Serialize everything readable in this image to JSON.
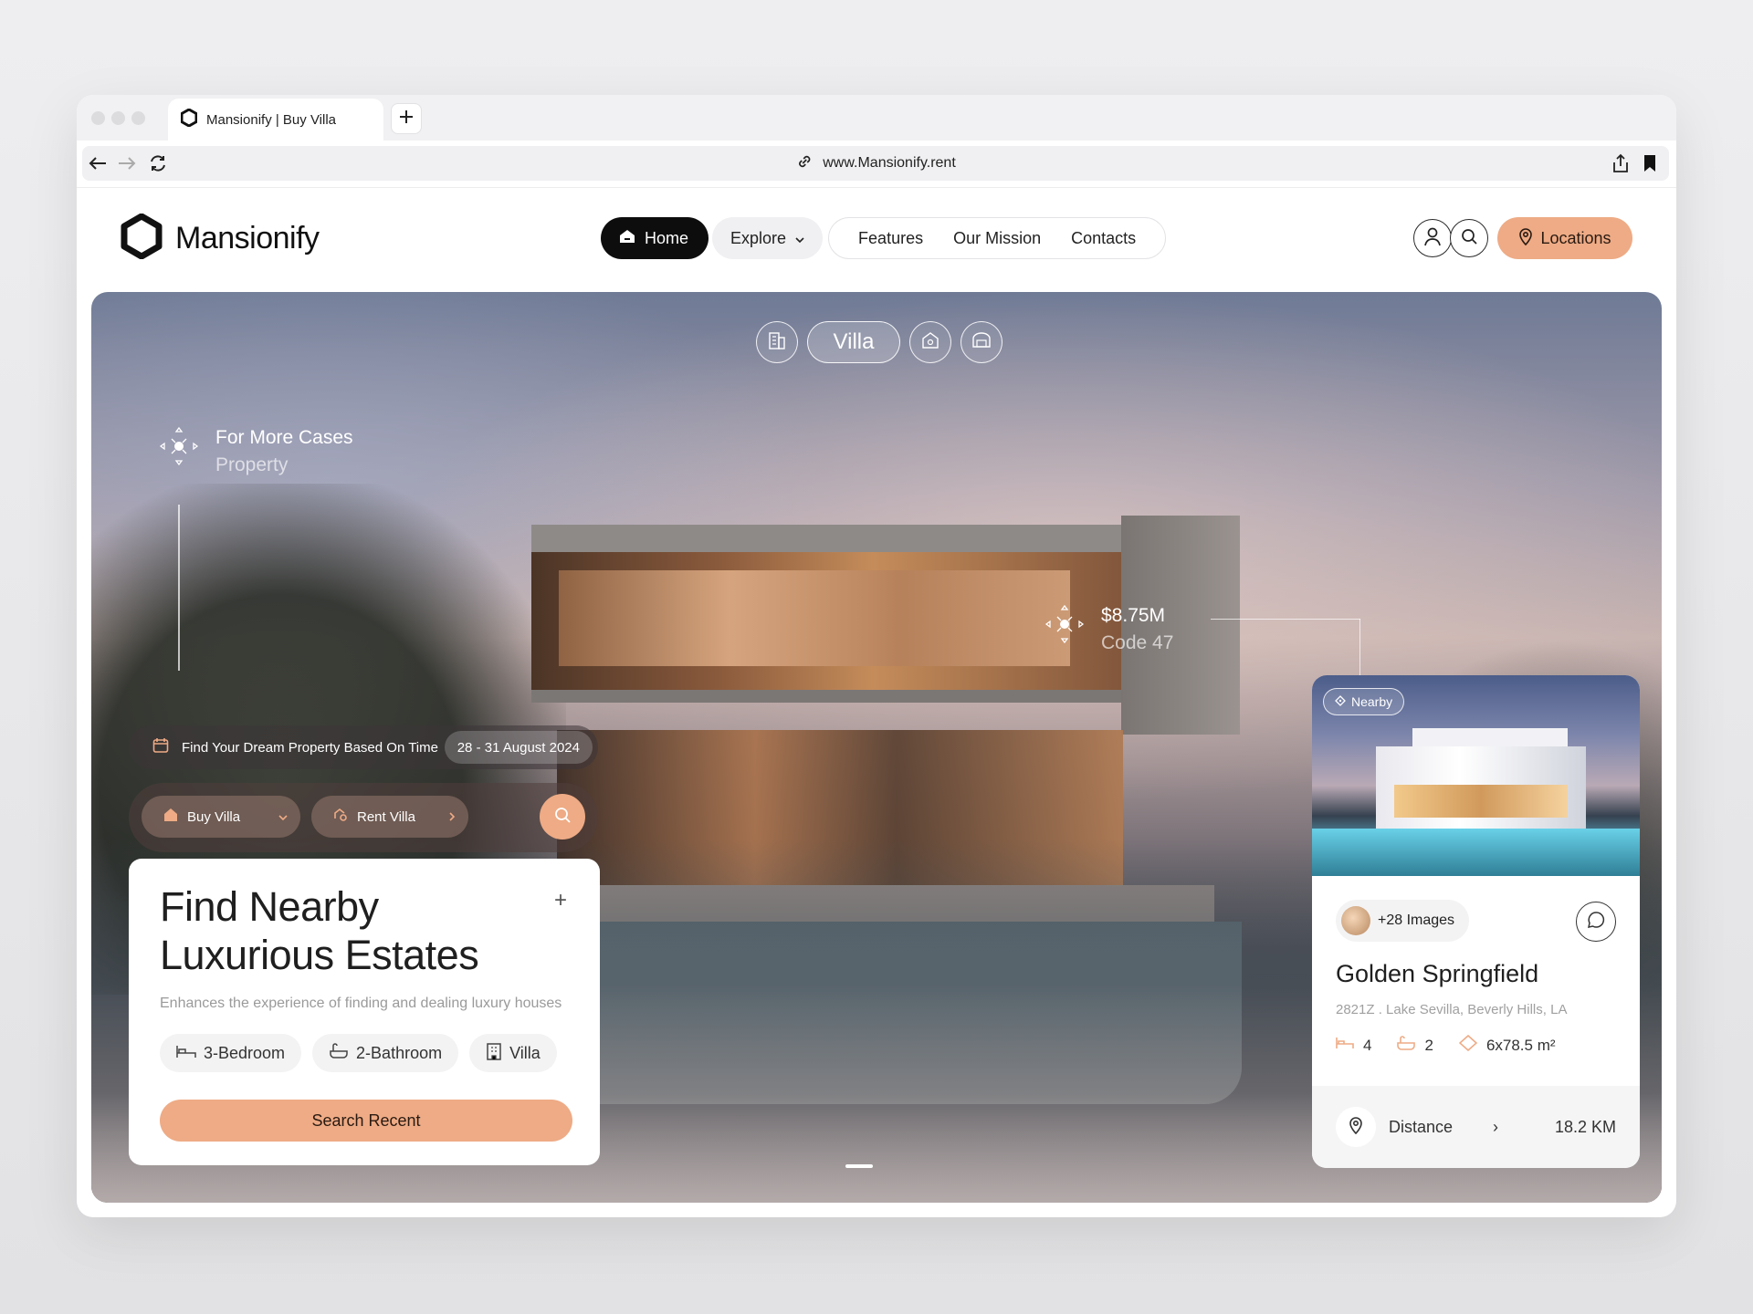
{
  "browser": {
    "tab_title": "Mansionify | Buy Villa",
    "url": "www.Mansionify.rent"
  },
  "header": {
    "logo_text": "Mansionify",
    "nav": {
      "home": "Home",
      "explore": "Explore",
      "features": "Features",
      "mission": "Our Mission",
      "contacts": "Contacts"
    },
    "locations_label": "Locations"
  },
  "hero": {
    "category_selected": "Villa",
    "marker_cases": {
      "line1": "For More Cases",
      "line2": "Property"
    },
    "marker_price": {
      "line1": "$8.75M",
      "line2": "Code 47"
    },
    "date_bar": {
      "text": "Find Your Dream Property Based On Time",
      "date": "28 - 31 August 2024"
    },
    "filters": {
      "buy": "Buy Villa",
      "rent": "Rent Villa"
    }
  },
  "find_card": {
    "title": "Find Nearby Luxurious Estates",
    "plus": "+",
    "description": "Enhances the experience of finding and dealing luxury houses",
    "tags": [
      "3-Bedroom",
      "2-Bathroom",
      "Villa"
    ],
    "button": "Search Recent"
  },
  "property": {
    "badge": "Nearby",
    "images_label": "+28 Images",
    "name": "Golden Springfield",
    "address": "2821Z . Lake Sevilla, Beverly Hills, LA",
    "beds": "4",
    "baths": "2",
    "area": "6x78.5 m²",
    "distance_label": "Distance",
    "distance_arrow": "›",
    "distance_value": "18.2 KM"
  },
  "colors": {
    "accent": "#eeab85",
    "dark": "#0d0d0d"
  }
}
